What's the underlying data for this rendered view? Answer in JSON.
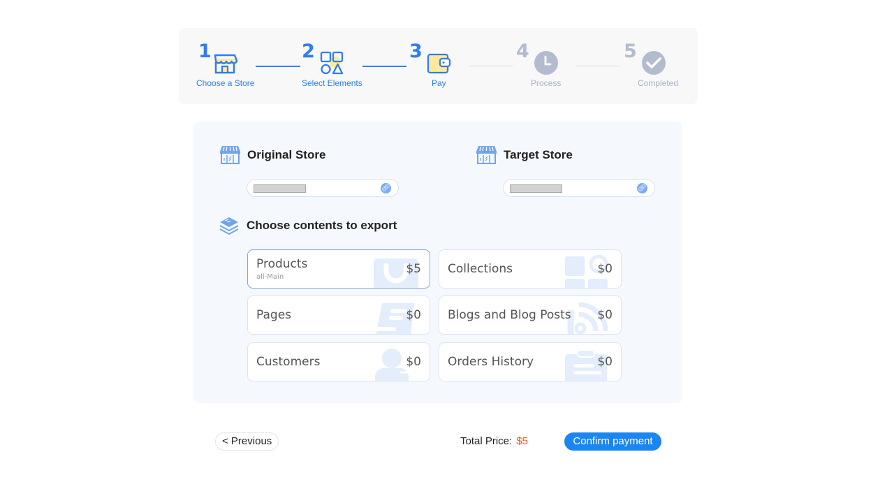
{
  "stepper": {
    "steps": [
      {
        "number": "1",
        "label": "Choose a Store",
        "icon": "store-icon",
        "state": "active"
      },
      {
        "number": "2",
        "label": "Select Elements",
        "icon": "shapes-icon",
        "state": "active"
      },
      {
        "number": "3",
        "label": "Pay",
        "icon": "wallet-icon",
        "state": "active"
      },
      {
        "number": "4",
        "label": "Process",
        "icon": "clock-icon",
        "state": "inactive"
      },
      {
        "number": "5",
        "label": "Completed",
        "icon": "check-circle-icon",
        "state": "inactive"
      }
    ]
  },
  "stores": {
    "original": {
      "title": "Original Store",
      "icon": "storefront-icon",
      "link_icon": "link-icon"
    },
    "target": {
      "title": "Target Store",
      "icon": "storefront-icon",
      "link_icon": "link-icon"
    }
  },
  "export": {
    "title": "Choose contents to export",
    "icon": "layers-icon",
    "items": [
      {
        "name": "Products",
        "sub": "all-Main",
        "price": "$5",
        "selected": true,
        "icon": "shopping-bag-icon"
      },
      {
        "name": "Collections",
        "sub": "",
        "price": "$0",
        "selected": false,
        "icon": "grid-search-icon"
      },
      {
        "name": "Pages",
        "sub": "",
        "price": "$0",
        "selected": false,
        "icon": "document-icon"
      },
      {
        "name": "Blogs and Blog Posts",
        "sub": "",
        "price": "$0",
        "selected": false,
        "icon": "rss-icon"
      },
      {
        "name": "Customers",
        "sub": "",
        "price": "$0",
        "selected": false,
        "icon": "users-icon"
      },
      {
        "name": "Orders History",
        "sub": "",
        "price": "$0",
        "selected": false,
        "icon": "clipboard-icon"
      }
    ]
  },
  "footer": {
    "previous_label": "< Previous",
    "total_label": "Total Price:",
    "total_amount": "$5",
    "confirm_label": "Confirm payment"
  },
  "colors": {
    "accent": "#2f7df1",
    "inactive": "#b3bccf",
    "price": "#f05a1a",
    "confirm": "#1a86f2"
  }
}
